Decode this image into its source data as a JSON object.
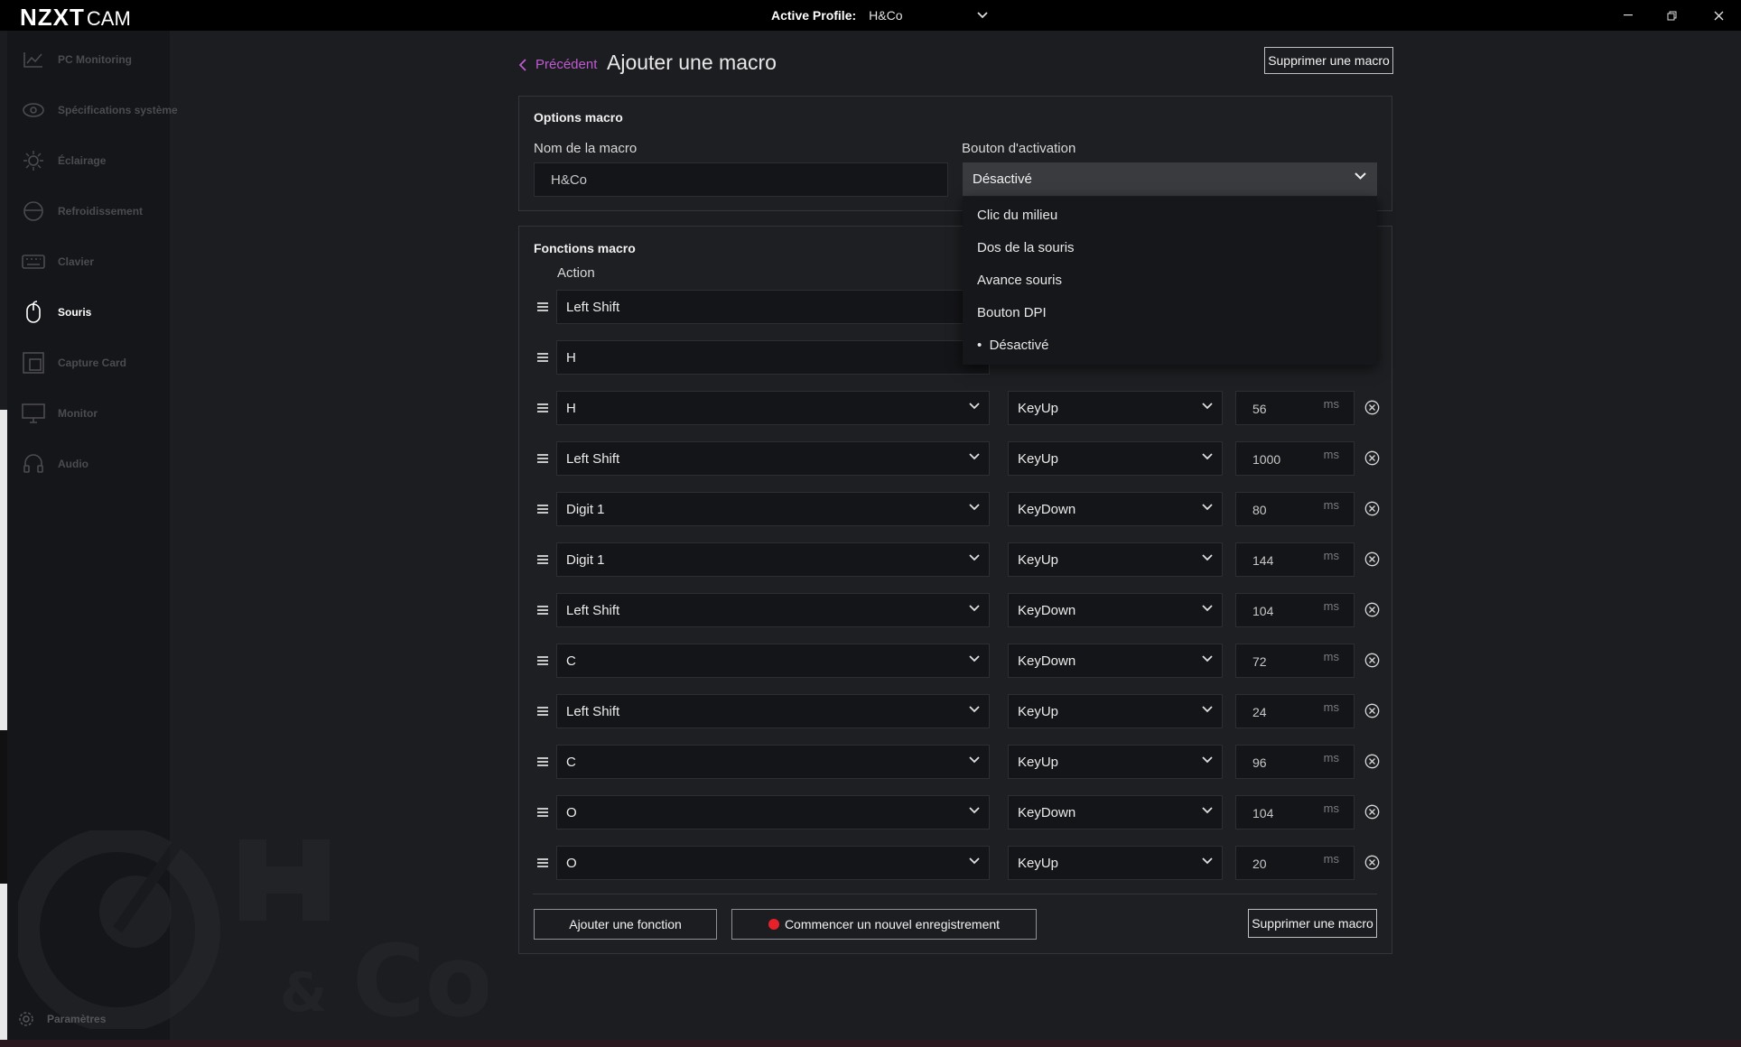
{
  "titlebar": {
    "brand": "NZXT",
    "brand_suffix": "CAM",
    "profile_label": "Active Profile:",
    "profile_value": "H&Co"
  },
  "sidebar": {
    "items": [
      {
        "label": "PC Monitoring",
        "icon": "chart-line-icon"
      },
      {
        "label": "Spécifications système",
        "icon": "eye-icon"
      },
      {
        "label": "Éclairage",
        "icon": "sun-icon"
      },
      {
        "label": "Refroidissement",
        "icon": "fan-icon"
      },
      {
        "label": "Clavier",
        "icon": "keyboard-icon"
      },
      {
        "label": "Souris",
        "icon": "mouse-icon",
        "active": true
      },
      {
        "label": "Capture Card",
        "icon": "capture-card-icon"
      },
      {
        "label": "Monitor",
        "icon": "monitor-icon"
      },
      {
        "label": "Audio",
        "icon": "headset-icon"
      }
    ],
    "settings_label": "Paramètres"
  },
  "header": {
    "back_label": "Précédent",
    "title": "Ajouter une macro",
    "delete_label": "Supprimer une macro"
  },
  "options": {
    "title": "Options macro",
    "name_label": "Nom de la macro",
    "name_value": "H&Co",
    "activation_label": "Bouton d'activation",
    "activation_value": "Désactivé",
    "dropdown_options": [
      "Clic du milieu",
      "Dos de la souris",
      "Avance souris",
      "Bouton DPI",
      "Désactivé"
    ],
    "dropdown_selected": "Désactivé"
  },
  "functions": {
    "title": "Fonctions macro",
    "action_header": "Action",
    "delay_unit": "ms",
    "rows": [
      {
        "key": "Left Shift",
        "event": "",
        "delay": ""
      },
      {
        "key": "H",
        "event": "",
        "delay": ""
      },
      {
        "key": "H",
        "event": "KeyUp",
        "delay": "56"
      },
      {
        "key": "Left Shift",
        "event": "KeyUp",
        "delay": "1000"
      },
      {
        "key": "Digit 1",
        "event": "KeyDown",
        "delay": "80"
      },
      {
        "key": "Digit 1",
        "event": "KeyUp",
        "delay": "144"
      },
      {
        "key": "Left Shift",
        "event": "KeyDown",
        "delay": "104"
      },
      {
        "key": "C",
        "event": "KeyDown",
        "delay": "72"
      },
      {
        "key": "Left Shift",
        "event": "KeyUp",
        "delay": "24"
      },
      {
        "key": "C",
        "event": "KeyUp",
        "delay": "96"
      },
      {
        "key": "O",
        "event": "KeyDown",
        "delay": "104"
      },
      {
        "key": "O",
        "event": "KeyUp",
        "delay": "20"
      }
    ],
    "add_label": "Ajouter une fonction",
    "record_label": "Commencer un nouvel enregistrement",
    "delete_label": "Supprimer une macro"
  },
  "colors": {
    "accent": "#c05ad0",
    "record": "#e8202a",
    "background": "#1c1d20",
    "sidebar": "#151619"
  }
}
